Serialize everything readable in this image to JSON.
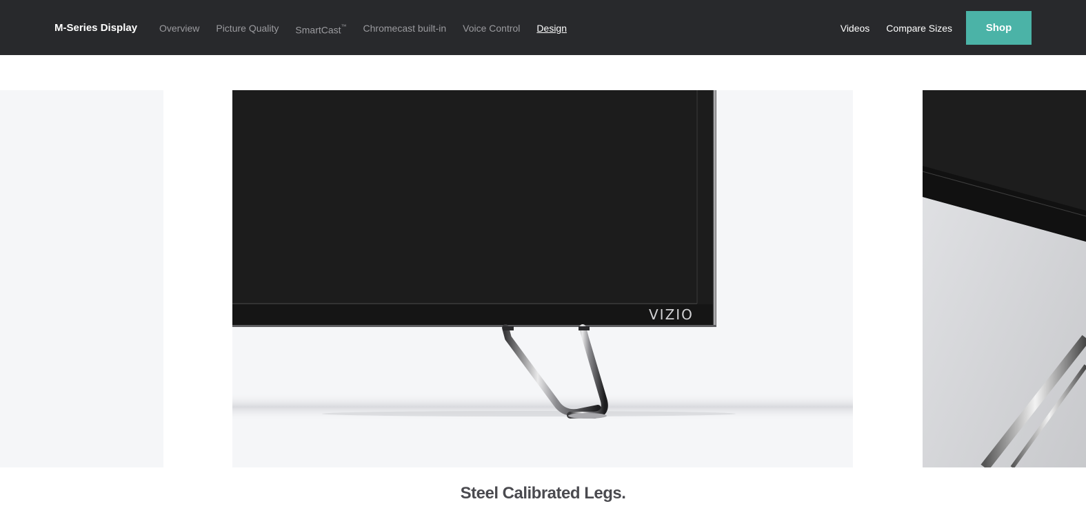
{
  "header": {
    "brand": "M-Series Display",
    "nav_links": [
      {
        "label": "Overview"
      },
      {
        "label": "Picture Quality"
      },
      {
        "label": "SmartCast",
        "superscript": "™"
      },
      {
        "label": "Chromecast built-in"
      },
      {
        "label": "Voice Control"
      },
      {
        "label": "Design",
        "active": true
      }
    ],
    "right_links": [
      {
        "label": "Videos"
      },
      {
        "label": "Compare Sizes"
      }
    ],
    "shop_label": "Shop"
  },
  "carousel": {
    "tv_logo": "VIZIO",
    "caption": "Steel Calibrated Legs."
  },
  "colors": {
    "nav_background": "#28292c",
    "shop_button": "#4bb3a7",
    "slide_background": "#f5f6f8",
    "caption_text": "#4a4a4f"
  }
}
